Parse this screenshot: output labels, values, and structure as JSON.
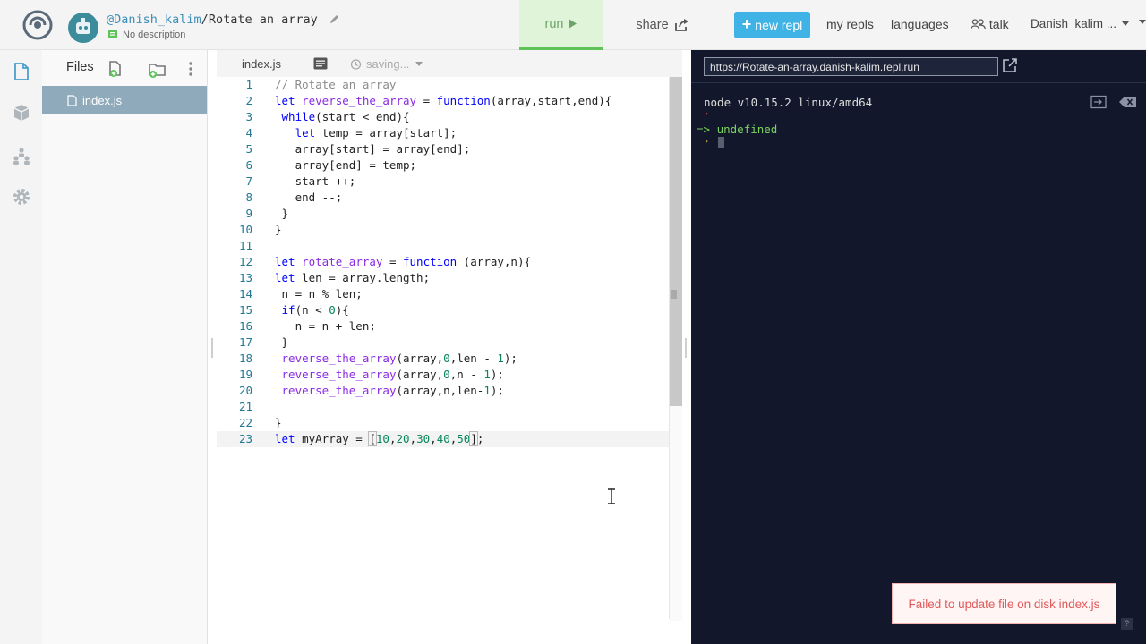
{
  "header": {
    "owner": "@Danish_kalim",
    "separator": "/",
    "repl_name": "Rotate an array",
    "description": "No description",
    "run_label": "run",
    "share_label": "share",
    "new_repl_label": "new repl",
    "my_repls_label": "my repls",
    "languages_label": "languages",
    "talk_label": "talk",
    "user_label": "Danish_kalim ..."
  },
  "files": {
    "title": "Files",
    "items": [
      {
        "name": "index.js"
      }
    ]
  },
  "editor": {
    "tab": "index.js",
    "status": "saving...",
    "active_line": 23,
    "lines": [
      {
        "n": "1"
      },
      {
        "n": "2"
      },
      {
        "n": "3"
      },
      {
        "n": "4"
      },
      {
        "n": "5"
      },
      {
        "n": "6"
      },
      {
        "n": "7"
      },
      {
        "n": "8"
      },
      {
        "n": "9"
      },
      {
        "n": "10"
      },
      {
        "n": "11"
      },
      {
        "n": "12"
      },
      {
        "n": "13"
      },
      {
        "n": "14"
      },
      {
        "n": "15"
      },
      {
        "n": "16"
      },
      {
        "n": "17"
      },
      {
        "n": "18"
      },
      {
        "n": "19"
      },
      {
        "n": "20"
      },
      {
        "n": "21"
      },
      {
        "n": "22"
      },
      {
        "n": "23"
      }
    ],
    "code": {
      "l1": "// Rotate an array",
      "l2_a": "let ",
      "l2_b": "reverse_the_array",
      "l2_c": " = ",
      "l2_d": "function",
      "l2_e": "(array,start,end){",
      "l3_a": " ",
      "l3_b": "while",
      "l3_c": "(start < end){",
      "l4_a": "   ",
      "l4_b": "let",
      "l4_c": " temp = array[start];",
      "l5": "   array[start] = array[end];",
      "l6": "   array[end] = temp;",
      "l7": "   start ++;",
      "l8": "   end --;",
      "l9": " }",
      "l10": "}",
      "l11": "",
      "l12_a": "let ",
      "l12_b": "rotate_array",
      "l12_c": " = ",
      "l12_d": "function",
      "l12_e": " (array,n){",
      "l13_a": "let",
      "l13_b": " len = array.length;",
      "l14": " n = n % len;",
      "l15_a": " ",
      "l15_b": "if",
      "l15_c": "(n < ",
      "l15_d": "0",
      "l15_e": "){",
      "l16": "   n = n + len;",
      "l17": " }",
      "l18_a": " ",
      "l18_b": "reverse_the_array",
      "l18_c": "(array,",
      "l18_d": "0",
      "l18_e": ",len - ",
      "l18_f": "1",
      "l18_g": ");",
      "l19_a": " ",
      "l19_b": "reverse_the_array",
      "l19_c": "(array,",
      "l19_d": "0",
      "l19_e": ",n - ",
      "l19_f": "1",
      "l19_g": ");",
      "l20_a": " ",
      "l20_b": "reverse_the_array",
      "l20_c": "(array,n,len-",
      "l20_d": "1",
      "l20_e": ");",
      "l21": "",
      "l22": "}",
      "l23_a": "let",
      "l23_b": " myArray = ",
      "l23_c": "[",
      "l23_d": "10",
      "l23_e": ",",
      "l23_f": "20",
      "l23_g": ",",
      "l23_h": "30",
      "l23_i": ",",
      "l23_j": "40",
      "l23_k": ",",
      "l23_l": "50",
      "l23_m": "]",
      "l23_n": ";"
    }
  },
  "console": {
    "url": "https://Rotate-an-array.danish-kalim.repl.run",
    "version_line": "node v10.15.2 linux/amd64",
    "prompt_symbol": "›",
    "result_prefix": "=>",
    "result_value": "undefined"
  },
  "toast": {
    "message": "Failed to update file on disk index.js"
  },
  "help": {
    "label": "?"
  },
  "colors": {
    "accent_blue": "#3fb3e6",
    "run_green": "#5fc35a",
    "console_bg": "#12172b",
    "error_red": "#e05a5a",
    "file_selected": "#8eaabb"
  }
}
